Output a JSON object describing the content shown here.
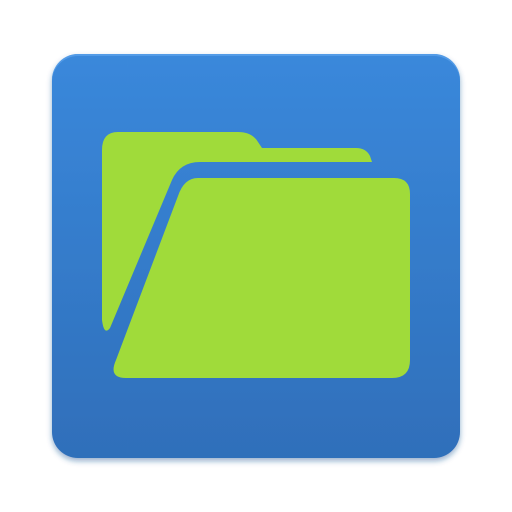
{
  "icon": {
    "name": "folder-app-icon",
    "glyph": "folder-icon"
  },
  "colors": {
    "tile_top": "#3a88db",
    "tile_bottom": "#2f6fba",
    "tile_highlight": "#5aa0ea",
    "folder_green": "#a0db3a",
    "shadow": "#1d4f8f"
  }
}
